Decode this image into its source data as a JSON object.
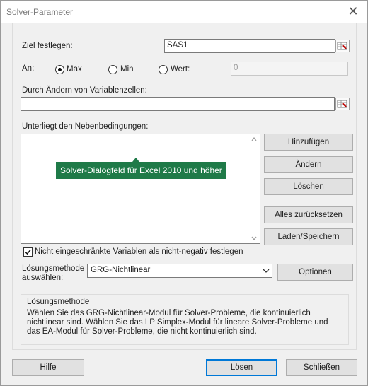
{
  "window": {
    "title": "Solver-Parameter"
  },
  "objective": {
    "label": "Ziel festlegen:",
    "value": "SAS1"
  },
  "to": {
    "label": "An:",
    "options": [
      {
        "label": "Max",
        "selected": true
      },
      {
        "label": "Min",
        "selected": false
      },
      {
        "label": "Wert:",
        "selected": false
      }
    ],
    "value_field": "0"
  },
  "variables": {
    "label": "Durch Ändern von Variablenzellen:",
    "value": ""
  },
  "constraints": {
    "label": "Unterliegt den Nebenbedingungen:",
    "tooltip": "Solver-Dialogfeld für Excel 2010 und höher",
    "buttons": {
      "add": "Hinzufügen",
      "change": "Ändern",
      "delete": "Löschen",
      "reset_all": "Alles zurücksetzen",
      "load_save": "Laden/Speichern"
    }
  },
  "nonnegative": {
    "label": "Nicht eingeschränkte Variablen als nicht-negativ festlegen",
    "checked": true
  },
  "method": {
    "label_line1": "Lösungsmethode",
    "label_line2": "auswählen:",
    "selected": "GRG-Nichtlinear",
    "options_button": "Optionen"
  },
  "method_group": {
    "title": "Lösungsmethode",
    "description": "Wählen Sie das GRG-Nichtlinear-Modul für Solver-Probleme, die kontinuierlich nichtlinear sind. Wählen Sie das LP Simplex-Modul für lineare Solver-Probleme und das EA-Modul für Solver-Probleme, die nicht kontinuierlich sind."
  },
  "footer": {
    "help": "Hilfe",
    "solve": "Lösen",
    "close": "Schließen"
  },
  "icons": {
    "close": "close-icon",
    "ref": "range-selector-icon",
    "check": "checkmark-icon",
    "dropdown": "chevron-down-icon"
  }
}
